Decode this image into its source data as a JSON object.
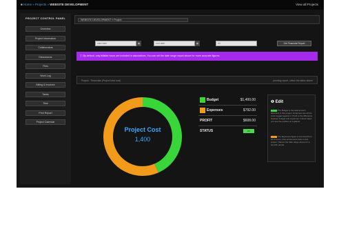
{
  "header": {
    "breadcrumb": [
      {
        "label": "Home",
        "kind": "link"
      },
      {
        "label": "» Projects »",
        "kind": "link"
      },
      {
        "label": "WEBSITE DEVELOPMENT",
        "kind": "current"
      }
    ],
    "right_link": "View all Projects"
  },
  "sidebar": {
    "title": "PROJECT CONTROL PANEL",
    "items": [
      {
        "label": "Overview"
      },
      {
        "label": "Project Information"
      },
      {
        "label": "Collaborators"
      },
      {
        "label": "Discussions"
      },
      {
        "label": "Files"
      },
      {
        "label": "Work Log"
      },
      {
        "label": "Billing & Invoices"
      },
      {
        "label": "Tasks"
      },
      {
        "label": "Time"
      },
      {
        "label": "Print Report"
      },
      {
        "label": "Project Calendar"
      }
    ]
  },
  "main": {
    "page_title": "WEBSITE DEVELOPMENT » Project",
    "filters": {
      "from_date": "start date",
      "to_date": "end date",
      "status_select": "All",
      "generate_button": "Get Financial Report"
    },
    "alert": "By default, only billable hours are included in calculations. You can set the date range report above for more accurate figures.",
    "section": {
      "left_label": "Project · Financials (Project total cost)",
      "right_label": "pending report, check the dates above"
    },
    "donut": {
      "title": "Project Cost",
      "value": "1,400"
    },
    "financials": {
      "rows": [
        {
          "label": "Budget",
          "value": "$1,400.00",
          "color": "#39d63a"
        },
        {
          "label": "Expenses",
          "value": "$792.00",
          "color": "#f29a1a"
        }
      ],
      "profit_label": "PROFIT",
      "profit_value": "$608.00",
      "status_label": "STATUS",
      "status_badge": "OK"
    },
    "edit_panel": {
      "title": "Edit",
      "para1": "The Budget is the total amount allocated to this project. Expenses are all the costs logged against it. Profit is the difference between budget and expenses. Colour helps you see the position at a glance.",
      "para2": "The Expenses figure is summed from all invoices, time entries and costs in this project. Narrow the date range above for a specific period."
    }
  },
  "chart_data": {
    "type": "pie",
    "variant": "donut",
    "title": "Project Cost",
    "center_value": "1,400",
    "slices": [
      {
        "label": "Budget remaining",
        "value": 608,
        "color": "#39d63a"
      },
      {
        "label": "Expenses",
        "value": 792,
        "color": "#f29a1a"
      }
    ]
  },
  "colors": {
    "accent_purple": "#a52aeb",
    "green": "#39d63a",
    "orange": "#f29a1a",
    "link_blue": "#5b9bd5"
  }
}
